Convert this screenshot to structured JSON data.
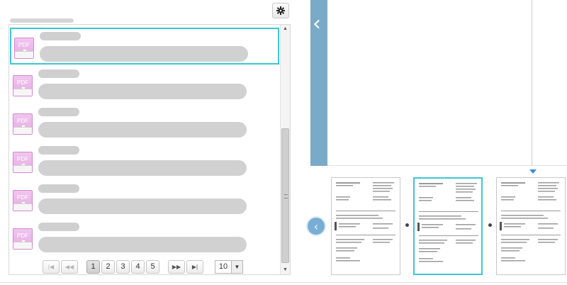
{
  "toolbar": {
    "settings_icon": "gear-icon"
  },
  "list": {
    "items": [
      {
        "icon_label": "PDF",
        "selected": true
      },
      {
        "icon_label": "PDF",
        "selected": false
      },
      {
        "icon_label": "PDF",
        "selected": false
      },
      {
        "icon_label": "PDF",
        "selected": false
      },
      {
        "icon_label": "PDF",
        "selected": false
      },
      {
        "icon_label": "PDF",
        "selected": false
      }
    ]
  },
  "pager": {
    "first": "|◀",
    "prev": "◀◀",
    "pages": [
      "1",
      "2",
      "3",
      "4",
      "5"
    ],
    "current_page": "1",
    "next": "▶▶",
    "last": "▶|",
    "page_size": "10"
  },
  "viewer": {
    "collapse_icon": "chevron-left-icon",
    "thumb_prev_icon": "chevron-left-icon",
    "thumbnails": [
      {
        "selected": false
      },
      {
        "selected": true
      },
      {
        "selected": false
      }
    ]
  },
  "colors": {
    "accent_teal": "#3cc6d4",
    "panel_blue": "#79aac8",
    "pdf_pink": "#e7a9e4",
    "marker_blue": "#3c8fd1"
  }
}
